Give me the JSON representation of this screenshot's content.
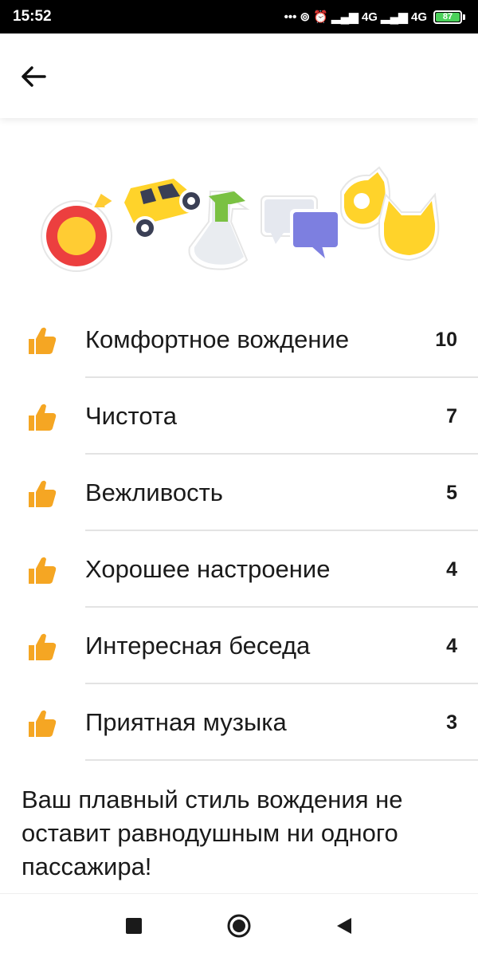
{
  "status_bar": {
    "time": "15:52",
    "indicators": "••• ⊚ ⏰ ▂▄▆ 4G ▂▄▆ 4G",
    "battery_level": "87"
  },
  "header": {
    "back_icon": "arrow-left-icon"
  },
  "hero": {
    "stickers": [
      "music-note-icon",
      "yellow-car-icon",
      "spray-bottle-icon",
      "chat-bubbles-icon",
      "ok-hand-icon",
      "cat-icon"
    ]
  },
  "ratings": [
    {
      "label": "Комфортное вождение",
      "count": "10"
    },
    {
      "label": "Чистота",
      "count": "7"
    },
    {
      "label": "Вежливость",
      "count": "5"
    },
    {
      "label": "Хорошее настроение",
      "count": "4"
    },
    {
      "label": "Интересная беседа",
      "count": "4"
    },
    {
      "label": "Приятная музыка",
      "count": "3"
    }
  ],
  "praise_text": "Ваш плавный стиль вождения не оставит равнодушным ни одного пассажира!",
  "colors": {
    "thumb": "#f5a623",
    "divider": "#e3e3e3",
    "battery": "#4bd15a"
  },
  "nav_bar": {
    "icons": [
      "recent-apps-icon",
      "home-icon",
      "back-triangle-icon"
    ]
  }
}
